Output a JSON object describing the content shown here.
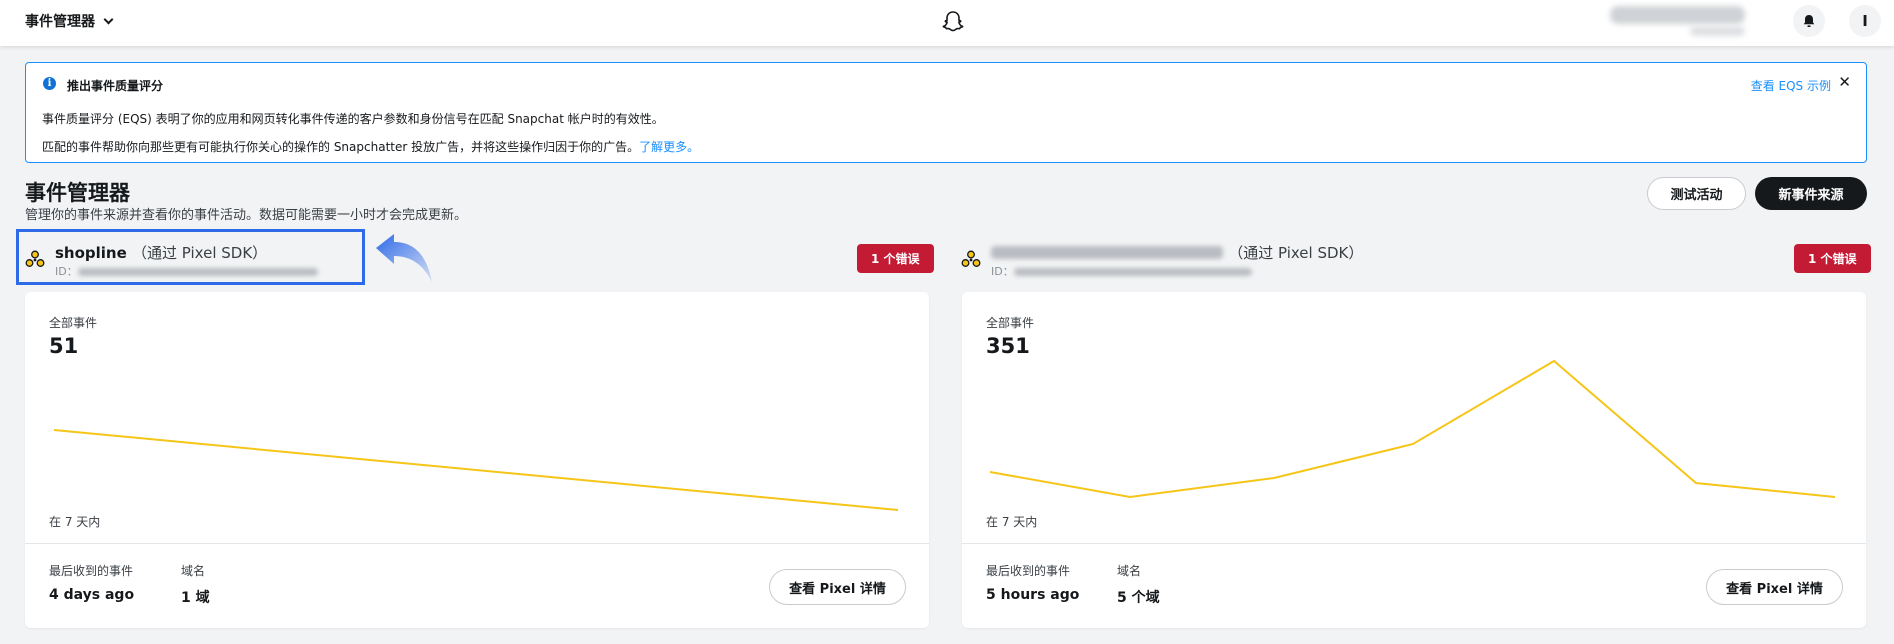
{
  "nav": {
    "app_name": "事件管理器"
  },
  "banner": {
    "title": "推出事件质量评分",
    "line1": "事件质量评分 (EQS) 表明了你的应用和网页转化事件传递的客户参数和身份信号在匹配 Snapchat 帐户时的有效性。",
    "line2": "匹配的事件帮助你向那些更有可能执行你关心的操作的 Snapchatter 投放广告，并将这些操作归因于你的广告。",
    "learn_more": "了解更多。",
    "eqs_link": "查看 EQS 示例",
    "close_glyph": "✕"
  },
  "header": {
    "title": "事件管理器",
    "subtitle": "管理你的事件来源并查看你的事件活动。数据可能需要一小时才会完成更新。",
    "test_button": "测试活动",
    "new_source_button": "新事件来源"
  },
  "sources": [
    {
      "name": "shopline",
      "via": "（通过 Pixel SDK）",
      "id_label": "ID：",
      "error_badge": "1 个错误",
      "card": {
        "total_label": "全部事件",
        "total": "51",
        "range": "在 7 天内",
        "last_received_label": "最后收到的事件",
        "last_received": "4 days ago",
        "domain_label": "域名",
        "domain_value": "1 域",
        "detail_button": "查看 Pixel 详情"
      }
    },
    {
      "name": "",
      "via": "（通过 Pixel SDK）",
      "id_label": "ID：",
      "error_badge": "1 个错误",
      "card": {
        "total_label": "全部事件",
        "total": "351",
        "range": "在 7 天内",
        "last_received_label": "最后收到的事件",
        "last_received": "5 hours ago",
        "domain_label": "域名",
        "domain_value": "5 个域",
        "detail_button": "查看 Pixel 详情"
      }
    }
  ],
  "colors": {
    "accent": "#1a8ffd",
    "error": "#c41b35",
    "sparkline": "#f5c518",
    "highlight": "#2f6ae8"
  }
}
